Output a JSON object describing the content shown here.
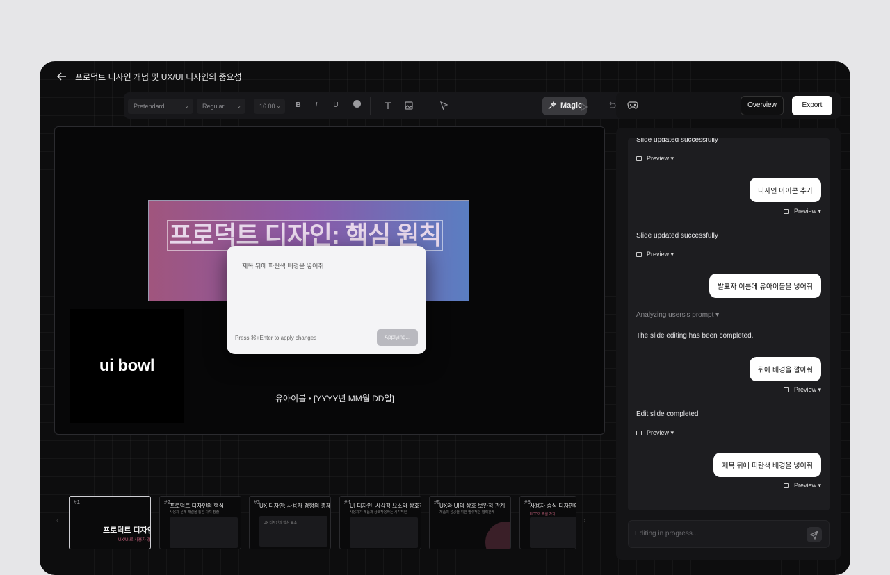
{
  "window": {
    "title": "프로덕트 디자인 개념 및 UX/UI 디자인의 중요성"
  },
  "toolbar": {
    "font_family": "Pretendard",
    "font_weight": "Regular",
    "font_size": "16.00",
    "bold": "B",
    "italic": "I",
    "underline": "U",
    "magic_label": "Magic"
  },
  "header": {
    "overview_label": "Overview",
    "export_label": "Export"
  },
  "slide": {
    "banner_title": "프로덕트 디자인: 핵심 원칙",
    "logo_text": "ui bowl",
    "presenter": "유아이볼 • [YYYY년 MM월 DD일]"
  },
  "prompt_popup": {
    "text": "제목 뒤에 파란색 배경을 넣어줘",
    "hint": "Press ⌘+Enter to apply changes",
    "button": "Applying..."
  },
  "thumbnails": [
    {
      "num": "#1",
      "title": "프로덕트 디자인",
      "subtitle": "UX/UI로 사용자 경험"
    },
    {
      "num": "#2",
      "title": "프로덕트 디자인의 핵심",
      "subtitle": "사용자 문제 해결을 통한 가치 창출"
    },
    {
      "num": "#3",
      "title": "UX 디자인: 사용자 경험의 총체적 설",
      "subtitle": "UX 디자인의 핵심 요소"
    },
    {
      "num": "#4",
      "title": "UI 디자인: 시각적 요소와 상호작용의",
      "subtitle": "사용자가 제품과 상호작용하는 시각적인"
    },
    {
      "num": "#5",
      "title": "UX와 UI의 상호 보완적 관계",
      "subtitle": "제품의 성공을 위한 필수적인 협력관계"
    },
    {
      "num": "#6",
      "title": "사용자 중심 디자인의 중",
      "subtitle": "UCD의 핵심 가치"
    }
  ],
  "chat": {
    "messages": [
      {
        "type": "sys",
        "text": "Slide updated successfully"
      },
      {
        "type": "preview",
        "text": "Preview"
      },
      {
        "type": "user",
        "text": "디자인 아이콘 추가"
      },
      {
        "type": "preview",
        "text": "Preview"
      },
      {
        "type": "sys",
        "text": "Slide updated successfully"
      },
      {
        "type": "preview",
        "text": "Preview"
      },
      {
        "type": "user",
        "text": "발표자 이름에 유아이볼을 넣어줘"
      },
      {
        "type": "sys",
        "text": "Analyzing users's prompt"
      },
      {
        "type": "sys",
        "text": "The slide editing has been completed."
      },
      {
        "type": "user",
        "text": "뒤에 배경을 깔아줘"
      },
      {
        "type": "preview",
        "text": "Preview"
      },
      {
        "type": "sys",
        "text": "Edit slide completed"
      },
      {
        "type": "preview",
        "text": "Preview"
      },
      {
        "type": "user",
        "text": "제목 뒤에 파란색 배경을 넣어줘"
      },
      {
        "type": "preview",
        "text": "Preview"
      }
    ],
    "input_placeholder": "Editing in progress..."
  }
}
